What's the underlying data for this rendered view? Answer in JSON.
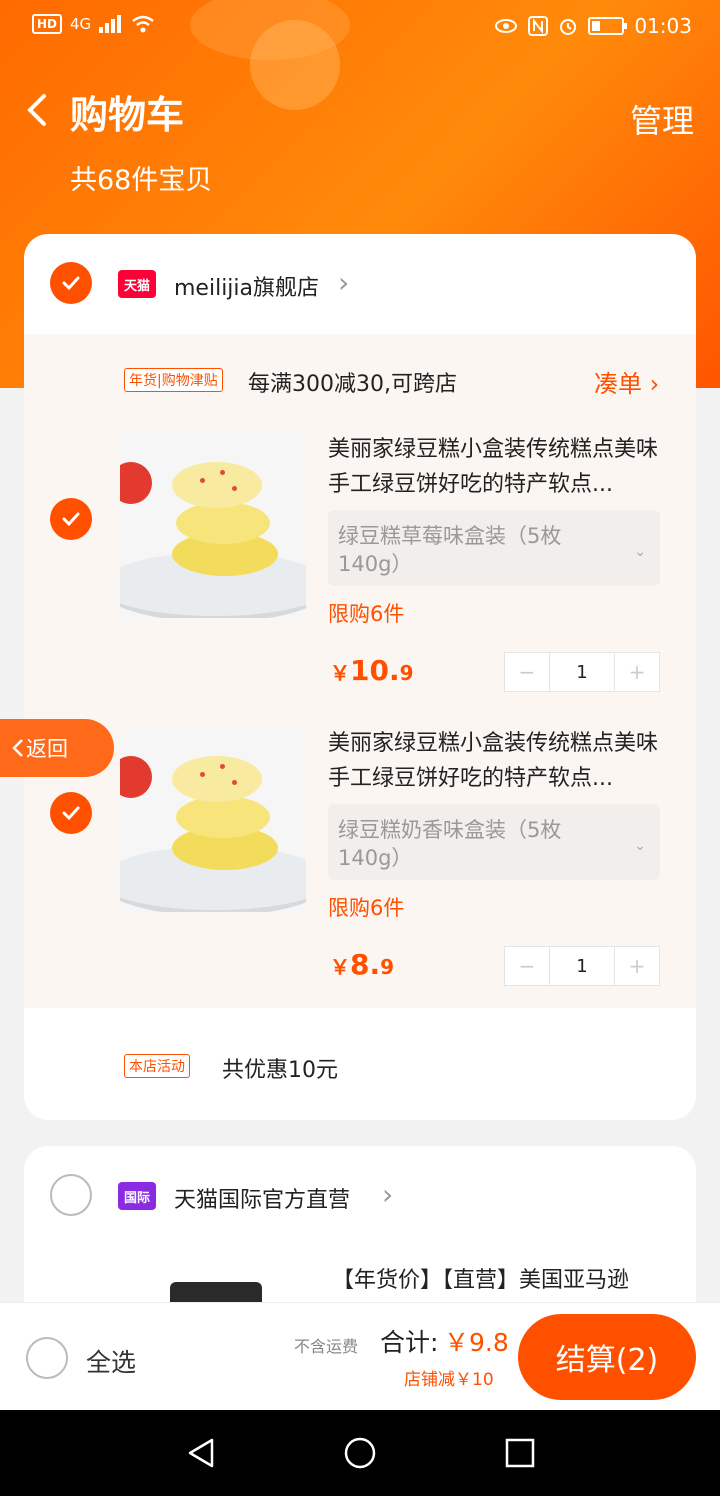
{
  "status_bar": {
    "left": "HD",
    "network": "4G",
    "time": "01:03"
  },
  "header": {
    "back_glyph": "‹",
    "title": "购物车",
    "manage": "管理",
    "count": "共68件宝贝"
  },
  "store1": {
    "name": "meilijia旗舰店",
    "badge": "天猫",
    "promo_tag": "年货|购物津贴",
    "promo_text": "每满300减30,可跨店",
    "add_on": "凑单",
    "items": [
      {
        "title": "美丽家绿豆糕小盒装传统糕点美味手工绿豆饼好吃的特产软点...",
        "sku": "绿豆糕草莓味盒装（5枚140g）",
        "limit": "限购6件",
        "price_symbol": "￥",
        "price_int": "10.",
        "price_dec": "9",
        "qty": "1"
      },
      {
        "title": "美丽家绿豆糕小盒装传统糕点美味手工绿豆饼好吃的特产软点...",
        "sku": "绿豆糕奶香味盒装（5枚140g）",
        "limit": "限购6件",
        "price_symbol": "￥",
        "price_int": "8.",
        "price_dec": "9",
        "qty": "1"
      }
    ],
    "activity_tag": "本店活动",
    "activity_text": "共优惠10元"
  },
  "store2": {
    "name": "天猫国际官方直营",
    "badge": "国际",
    "item_title": "【年货价】【直营】美国亚马逊"
  },
  "return_tab": "返回",
  "bottom": {
    "select_all": "全选",
    "shipping": "不含运费",
    "total_label": "合计:",
    "total_value": "￥9.8",
    "discount": "店铺减￥10",
    "checkout": "结算(2)"
  },
  "colors": {
    "accent": "#ff5000",
    "header_gradient": "#ff6a00"
  }
}
